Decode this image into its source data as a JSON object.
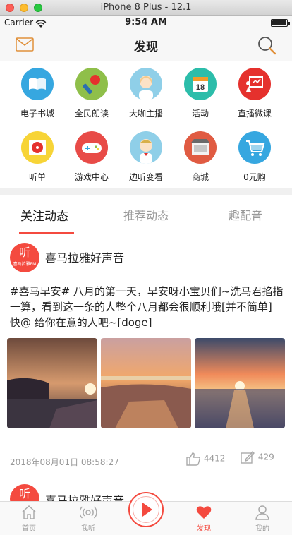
{
  "simulator": {
    "title": "iPhone 8 Plus - 12.1"
  },
  "status": {
    "carrier": "Carrier",
    "time": "9:54 AM"
  },
  "nav": {
    "title": "发现"
  },
  "grid": [
    {
      "label": "电子书城",
      "icon": "book-icon",
      "color": "#36a7e0"
    },
    {
      "label": "全民朗读",
      "icon": "microphone-icon",
      "color": "#8fbf4a"
    },
    {
      "label": "大咖主播",
      "icon": "presenter-icon",
      "color": "#8fcfe8"
    },
    {
      "label": "活动",
      "icon": "calendar-icon",
      "color": "#2cbdaa"
    },
    {
      "label": "直播微课",
      "icon": "whiteboard-icon",
      "color": "#e5312d"
    },
    {
      "label": "听单",
      "icon": "record-player-icon",
      "color": "#f7d437"
    },
    {
      "label": "游戏中心",
      "icon": "gamepad-icon",
      "color": "#e84b47"
    },
    {
      "label": "边听变看",
      "icon": "character-icon",
      "color": "#8fcfe8"
    },
    {
      "label": "商城",
      "icon": "store-icon",
      "color": "#e05b42"
    },
    {
      "label": "0元购",
      "icon": "cart-icon",
      "color": "#36a7e0"
    }
  ],
  "tabs": {
    "follow": "关注动态",
    "recommend": "推荐动态",
    "dubbing": "趣配音"
  },
  "post": {
    "avatar_text": "听",
    "avatar_subtext": "喜马拉雅FM",
    "author": "喜马拉雅好声音",
    "line1": "#喜马早安# 八月的第一天，早安呀小宝贝们~洗马君掐指",
    "line2": "一算，看到这一条的人整个八月都会很顺利哦[并不简单]",
    "line3": "快@ 给你在意的人吧~[doge]",
    "date": "2018年08月01日 08:58:27",
    "likes": "4412",
    "comments": "429"
  },
  "post2": {
    "author": "喜马拉雅好声音"
  },
  "tabbar": {
    "home": "首页",
    "listen": "我听",
    "discover": "发现",
    "mine": "我的"
  },
  "colors": {
    "accent": "#f44a3f"
  }
}
